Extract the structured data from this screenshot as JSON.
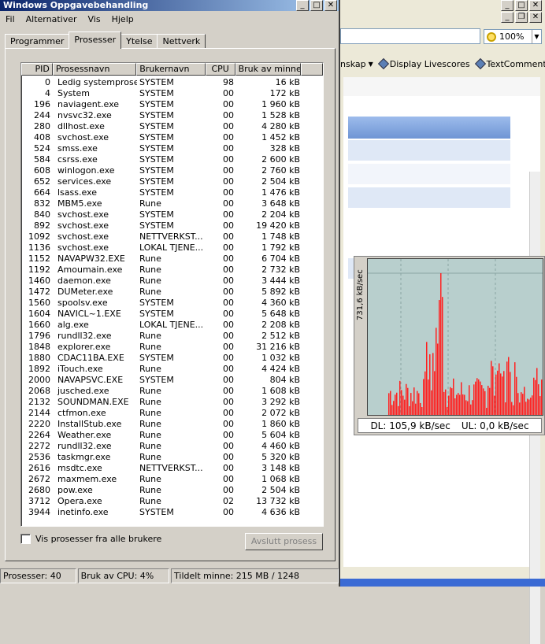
{
  "taskmanager": {
    "title": "Windows Oppgavebehandling",
    "menu": [
      "Fil",
      "Alternativer",
      "Vis",
      "Hjelp"
    ],
    "tabs": [
      "Programmer",
      "Prosesser",
      "Ytelse",
      "Nettverk"
    ],
    "active_tab": 1,
    "columns": [
      "PID",
      "Prosessnavn",
      "Brukernavn",
      "CPU",
      "Bruk av minne"
    ],
    "processes": [
      {
        "pid": "0",
        "name": "Ledig systemprosess",
        "user": "SYSTEM",
        "cpu": "98",
        "mem": "16 kB"
      },
      {
        "pid": "4",
        "name": "System",
        "user": "SYSTEM",
        "cpu": "00",
        "mem": "172 kB"
      },
      {
        "pid": "196",
        "name": "naviagent.exe",
        "user": "SYSTEM",
        "cpu": "00",
        "mem": "1 960 kB"
      },
      {
        "pid": "244",
        "name": "nvsvc32.exe",
        "user": "SYSTEM",
        "cpu": "00",
        "mem": "1 528 kB"
      },
      {
        "pid": "280",
        "name": "dllhost.exe",
        "user": "SYSTEM",
        "cpu": "00",
        "mem": "4 280 kB"
      },
      {
        "pid": "408",
        "name": "svchost.exe",
        "user": "SYSTEM",
        "cpu": "00",
        "mem": "1 452 kB"
      },
      {
        "pid": "524",
        "name": "smss.exe",
        "user": "SYSTEM",
        "cpu": "00",
        "mem": "328 kB"
      },
      {
        "pid": "584",
        "name": "csrss.exe",
        "user": "SYSTEM",
        "cpu": "00",
        "mem": "2 600 kB"
      },
      {
        "pid": "608",
        "name": "winlogon.exe",
        "user": "SYSTEM",
        "cpu": "00",
        "mem": "2 760 kB"
      },
      {
        "pid": "652",
        "name": "services.exe",
        "user": "SYSTEM",
        "cpu": "00",
        "mem": "2 504 kB"
      },
      {
        "pid": "664",
        "name": "lsass.exe",
        "user": "SYSTEM",
        "cpu": "00",
        "mem": "1 476 kB"
      },
      {
        "pid": "832",
        "name": "MBM5.exe",
        "user": "Rune",
        "cpu": "00",
        "mem": "3 648 kB"
      },
      {
        "pid": "840",
        "name": "svchost.exe",
        "user": "SYSTEM",
        "cpu": "00",
        "mem": "2 204 kB"
      },
      {
        "pid": "892",
        "name": "svchost.exe",
        "user": "SYSTEM",
        "cpu": "00",
        "mem": "19 420 kB"
      },
      {
        "pid": "1092",
        "name": "svchost.exe",
        "user": "NETTVERKST...",
        "cpu": "00",
        "mem": "1 748 kB"
      },
      {
        "pid": "1136",
        "name": "svchost.exe",
        "user": "LOKAL TJENE...",
        "cpu": "00",
        "mem": "1 792 kB"
      },
      {
        "pid": "1152",
        "name": "NAVAPW32.EXE",
        "user": "Rune",
        "cpu": "00",
        "mem": "6 704 kB"
      },
      {
        "pid": "1192",
        "name": "Amoumain.exe",
        "user": "Rune",
        "cpu": "00",
        "mem": "2 732 kB"
      },
      {
        "pid": "1460",
        "name": "daemon.exe",
        "user": "Rune",
        "cpu": "00",
        "mem": "3 444 kB"
      },
      {
        "pid": "1472",
        "name": "DUMeter.exe",
        "user": "Rune",
        "cpu": "00",
        "mem": "5 892 kB"
      },
      {
        "pid": "1560",
        "name": "spoolsv.exe",
        "user": "SYSTEM",
        "cpu": "00",
        "mem": "4 360 kB"
      },
      {
        "pid": "1604",
        "name": "NAVICL~1.EXE",
        "user": "SYSTEM",
        "cpu": "00",
        "mem": "5 648 kB"
      },
      {
        "pid": "1660",
        "name": "alg.exe",
        "user": "LOKAL TJENE...",
        "cpu": "00",
        "mem": "2 208 kB"
      },
      {
        "pid": "1796",
        "name": "rundll32.exe",
        "user": "Rune",
        "cpu": "00",
        "mem": "2 512 kB"
      },
      {
        "pid": "1848",
        "name": "explorer.exe",
        "user": "Rune",
        "cpu": "00",
        "mem": "31 216 kB"
      },
      {
        "pid": "1880",
        "name": "CDAC11BA.EXE",
        "user": "SYSTEM",
        "cpu": "00",
        "mem": "1 032 kB"
      },
      {
        "pid": "1892",
        "name": "iTouch.exe",
        "user": "Rune",
        "cpu": "00",
        "mem": "4 424 kB"
      },
      {
        "pid": "2000",
        "name": "NAVAPSVC.EXE",
        "user": "SYSTEM",
        "cpu": "00",
        "mem": "804 kB"
      },
      {
        "pid": "2068",
        "name": "jusched.exe",
        "user": "Rune",
        "cpu": "00",
        "mem": "1 608 kB"
      },
      {
        "pid": "2132",
        "name": "SOUNDMAN.EXE",
        "user": "Rune",
        "cpu": "00",
        "mem": "3 292 kB"
      },
      {
        "pid": "2144",
        "name": "ctfmon.exe",
        "user": "Rune",
        "cpu": "00",
        "mem": "2 072 kB"
      },
      {
        "pid": "2220",
        "name": "InstallStub.exe",
        "user": "Rune",
        "cpu": "00",
        "mem": "1 860 kB"
      },
      {
        "pid": "2264",
        "name": "Weather.exe",
        "user": "Rune",
        "cpu": "00",
        "mem": "5 604 kB"
      },
      {
        "pid": "2272",
        "name": "rundll32.exe",
        "user": "Rune",
        "cpu": "00",
        "mem": "4 460 kB"
      },
      {
        "pid": "2536",
        "name": "taskmgr.exe",
        "user": "Rune",
        "cpu": "00",
        "mem": "5 320 kB"
      },
      {
        "pid": "2616",
        "name": "msdtc.exe",
        "user": "NETTVERKST...",
        "cpu": "00",
        "mem": "3 148 kB"
      },
      {
        "pid": "2672",
        "name": "maxmem.exe",
        "user": "Rune",
        "cpu": "00",
        "mem": "1 068 kB"
      },
      {
        "pid": "2680",
        "name": "pow.exe",
        "user": "Rune",
        "cpu": "00",
        "mem": "2 504 kB"
      },
      {
        "pid": "3712",
        "name": "Opera.exe",
        "user": "Rune",
        "cpu": "02",
        "mem": "13 732 kB"
      },
      {
        "pid": "3944",
        "name": "inetinfo.exe",
        "user": "SYSTEM",
        "cpu": "00",
        "mem": "4 636 kB"
      }
    ],
    "show_all_label": "Vis prosesser fra alle brukere",
    "end_process_label": "Avslutt prosess",
    "status": {
      "processes": "Prosesser: 40",
      "cpu": "Bruk av CPU: 4%",
      "memory": "Tildelt minne: 215 MB / 1248"
    }
  },
  "browser": {
    "zoom": "100%",
    "links": [
      {
        "label": "nskap",
        "has_dropdown": true,
        "icon": "link-diamond-icon"
      },
      {
        "label": "Display Livescores",
        "icon": "link-diamond-icon"
      },
      {
        "label": "TextCommentary",
        "icon": "link-diamond-icon"
      }
    ]
  },
  "dumeter": {
    "ylabel": "731,6 kB/sec",
    "download": "DL: 105,9 kB/sec",
    "upload": "UL: 0,0 kB/sec",
    "graph_color": "#ff2020",
    "background_color": "#b8cfcd"
  },
  "colors": {
    "titlebar_start": "#0a246a",
    "titlebar_end": "#a6caf0",
    "window": "#d4d0c8"
  }
}
